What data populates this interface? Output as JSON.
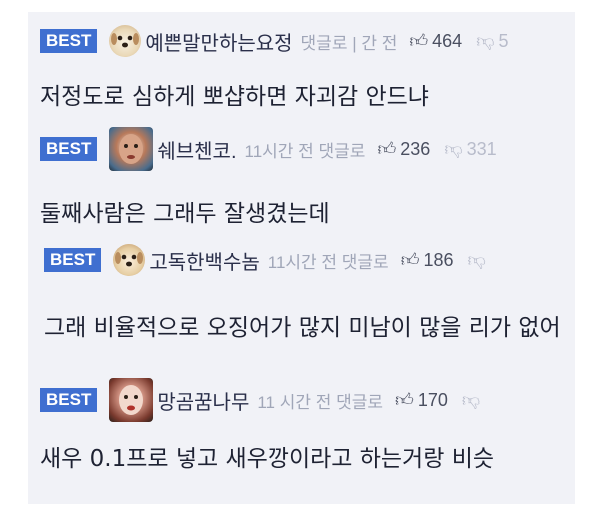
{
  "comments": [
    {
      "badge": "BEST",
      "nickname": "예쁜말만하는요정",
      "time": "댓글로 | 간 전",
      "likes": "464",
      "dislikes": "5",
      "text": "저정도로 심하게 뽀샵하면 자괴감 안드냐"
    },
    {
      "badge": "BEST",
      "nickname": "쉐브첸코.",
      "time": "11시간 전 댓글로",
      "likes": "236",
      "dislikes": "331",
      "text": "둘째사람은 그래두 잘생겼는데"
    },
    {
      "badge": "BEST",
      "nickname": "고독한백수놈",
      "time": "11시간 전 댓글로",
      "likes": "186",
      "dislikes": "",
      "text": "그래 비율적으로 오징어가 많지 미남이 많을 리가 없어"
    },
    {
      "badge": "BEST",
      "nickname": "망곰꿈나무",
      "time": "11 시간 전 댓글로",
      "likes": "170",
      "dislikes": "",
      "text": "새우 0.1프로 넣고 새우깡이라고 하는거랑 비슷"
    }
  ],
  "icons": {
    "like": "thumbs-up-icon",
    "dislike": "thumbs-down-icon"
  },
  "colors": {
    "badge": "#3f6fd0",
    "panel": "#f1f2f7",
    "text": "#1e2233",
    "muted": "#a0a6b8"
  }
}
